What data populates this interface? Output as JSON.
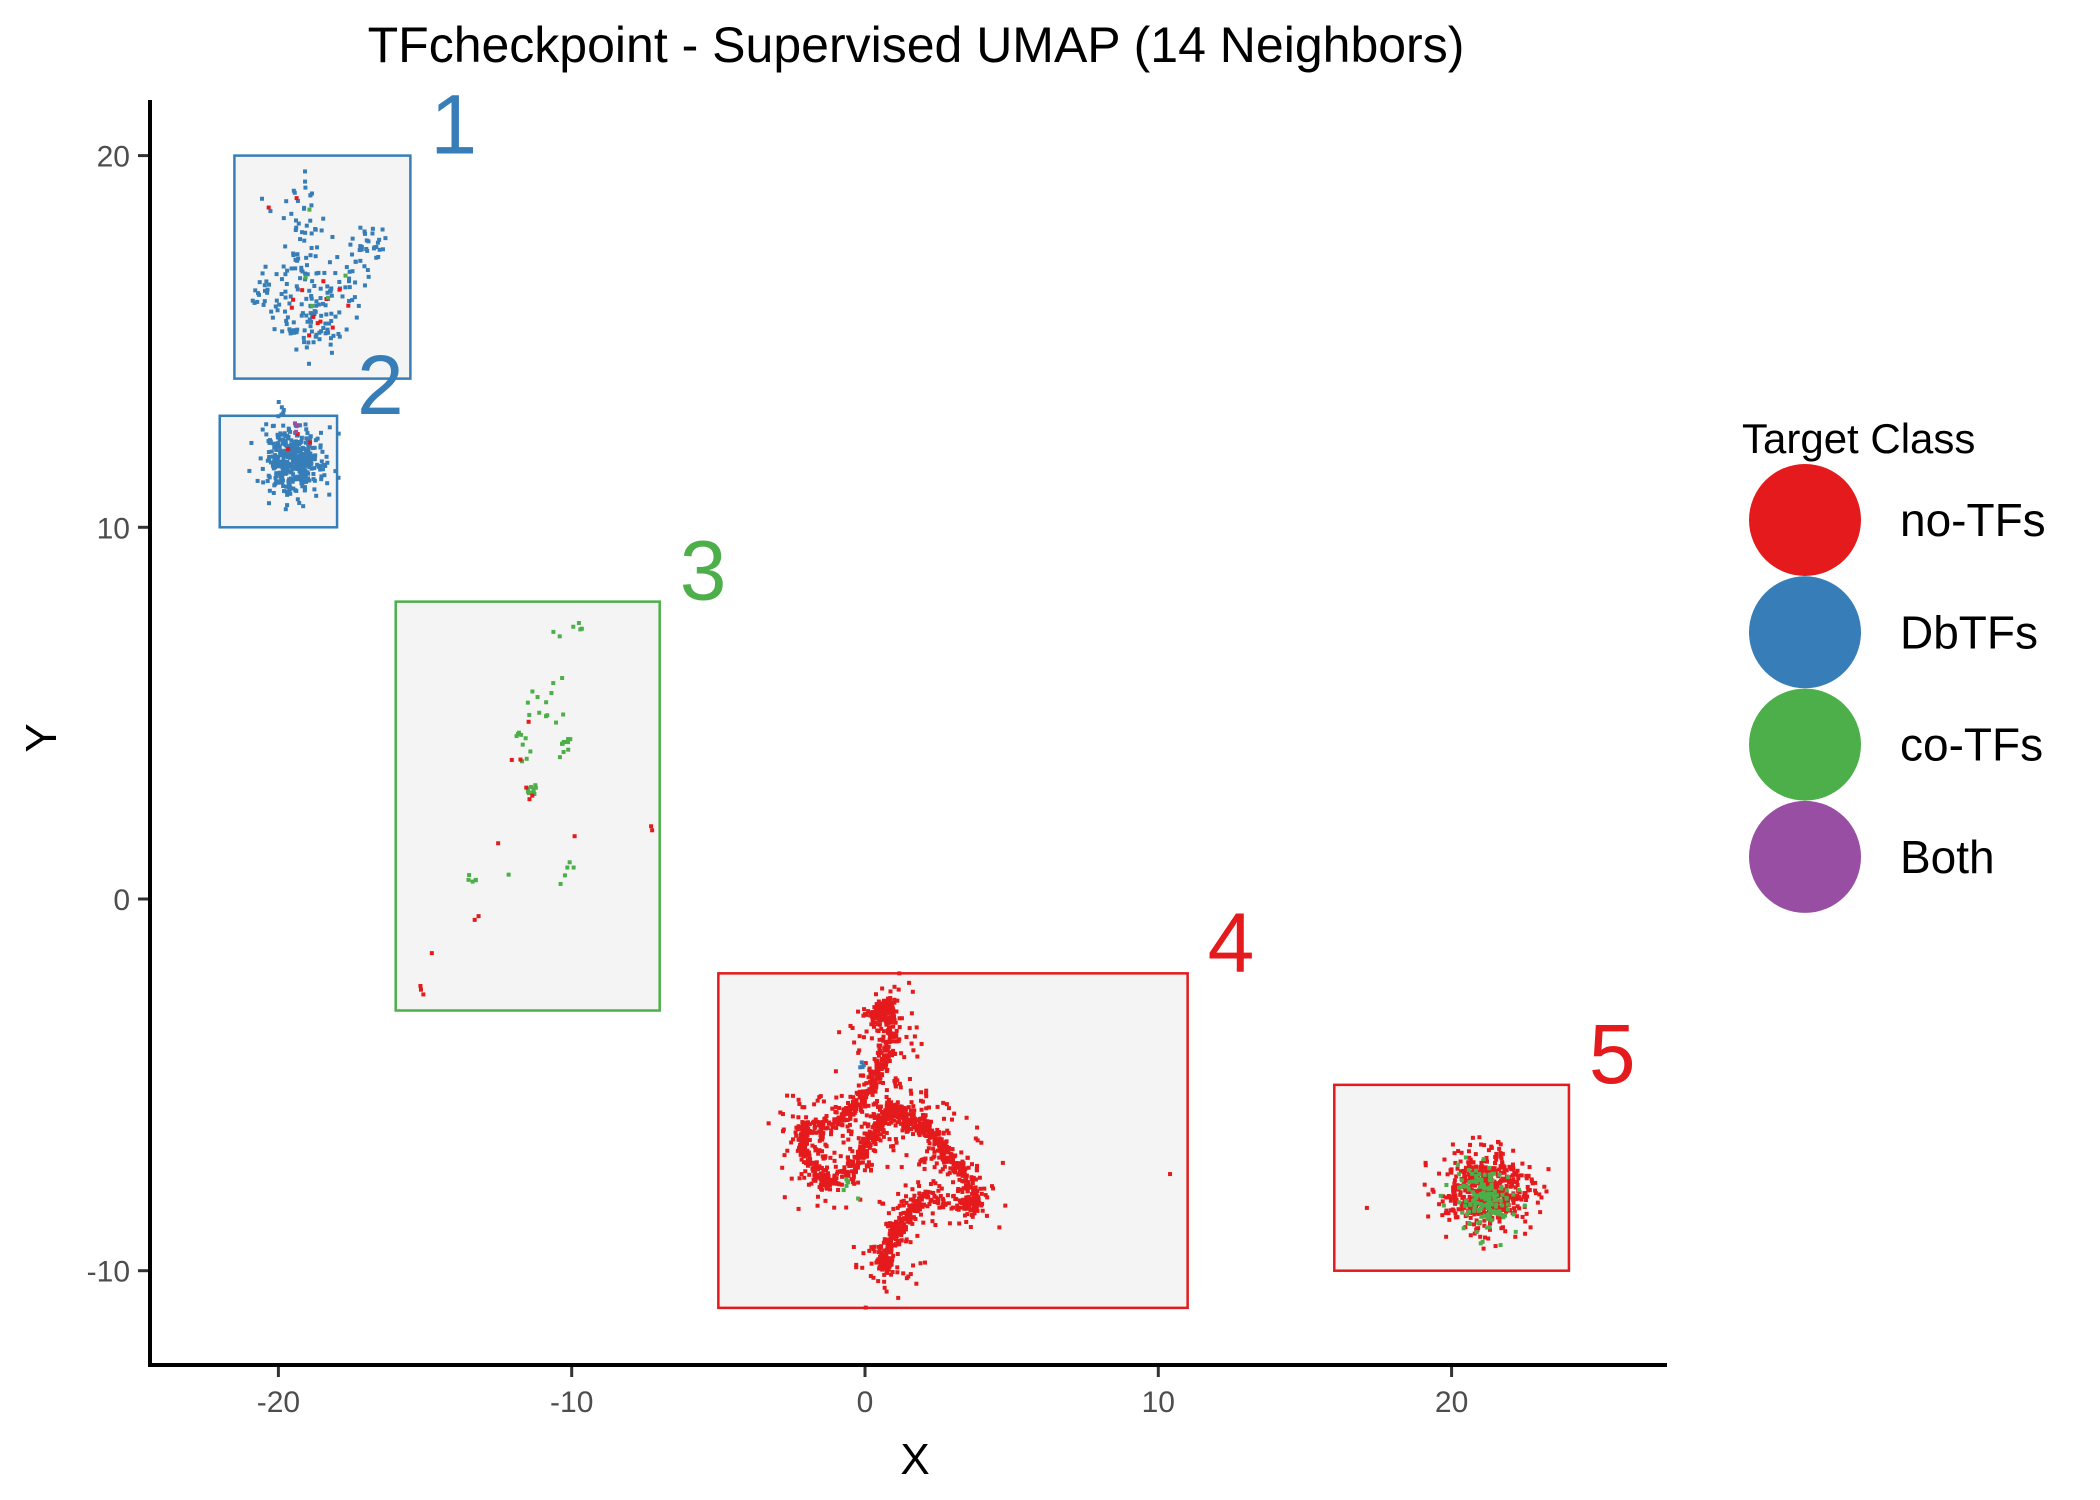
{
  "chart_data": {
    "type": "scatter",
    "title": "TFcheckpoint - Supervised UMAP (14 Neighbors)",
    "xlabel": "X",
    "ylabel": "Y",
    "xlim": [
      -24.3,
      27.2
    ],
    "ylim": [
      -12.5,
      21.6
    ],
    "xticks": [
      -20,
      -10,
      0,
      10,
      20
    ],
    "yticks": [
      -10,
      0,
      10,
      20
    ],
    "grid": false,
    "legend": {
      "title": "Target Class",
      "position": "right",
      "entries": [
        {
          "label": "no-TFs",
          "color": "#E41A1C"
        },
        {
          "label": "DbTFs",
          "color": "#377EB8"
        },
        {
          "label": "co-TFs",
          "color": "#4DAF4A"
        },
        {
          "label": "Both",
          "color": "#984EA3"
        }
      ]
    },
    "regions": [
      {
        "label": "1",
        "color": "#377EB8",
        "xmin": -21.5,
        "xmax": -15.5,
        "ymin": 14,
        "ymax": 20
      },
      {
        "label": "2",
        "color": "#377EB8",
        "xmin": -22,
        "xmax": -18,
        "ymin": 10,
        "ymax": 13
      },
      {
        "label": "3",
        "color": "#4DAF4A",
        "xmin": -16,
        "xmax": -7,
        "ymin": -3,
        "ymax": 8
      },
      {
        "label": "4",
        "color": "#E41A1C",
        "xmin": -5,
        "xmax": 11,
        "ymin": -11,
        "ymax": -2
      },
      {
        "label": "5",
        "color": "#E41A1C",
        "xmin": 16,
        "xmax": 24,
        "ymin": -10,
        "ymax": -5
      }
    ],
    "clusters": [
      {
        "region": "1",
        "class": "DbTFs",
        "count": 230,
        "shape": "branches",
        "anchors": [
          [
            -19.2,
            19.0
          ],
          [
            -19.0,
            17.8
          ],
          [
            -19.6,
            16.6
          ],
          [
            -18.6,
            16.0
          ],
          [
            -17.0,
            17.5
          ],
          [
            -20.3,
            16.2
          ],
          [
            -19.4,
            15.2
          ],
          [
            -18.4,
            15.3
          ],
          [
            -16.4,
            17.6
          ]
        ],
        "spread": 0.35
      },
      {
        "region": "1",
        "class": "no-TFs",
        "count": 14,
        "shape": "branches",
        "anchors": [
          [
            -19.2,
            18.8
          ],
          [
            -19.0,
            16.0
          ],
          [
            -18.5,
            15.5
          ],
          [
            -19.6,
            15.8
          ]
        ],
        "spread": 0.5
      },
      {
        "region": "1",
        "class": "co-TFs",
        "count": 5,
        "shape": "branches",
        "anchors": [
          [
            -19.1,
            18.6
          ],
          [
            -19.3,
            17.0
          ],
          [
            -18.8,
            15.8
          ],
          [
            -16.6,
            17.6
          ]
        ],
        "spread": 0.2
      },
      {
        "region": "2",
        "class": "DbTFs",
        "count": 420,
        "shape": "blob",
        "center": [
          -19.5,
          11.8
        ],
        "sx": 0.5,
        "sy": 0.45
      },
      {
        "region": "2",
        "class": "no-TFs",
        "count": 3,
        "shape": "blob",
        "center": [
          -19.2,
          12.4
        ],
        "sx": 0.3,
        "sy": 0.2
      },
      {
        "region": "2",
        "class": "Both",
        "count": 3,
        "shape": "blob",
        "center": [
          -19.4,
          12.7
        ],
        "sx": 0.05,
        "sy": 0.15
      },
      {
        "region": "3",
        "class": "co-TFs",
        "count": 60,
        "shape": "branches",
        "anchors": [
          [
            -11.2,
            5.4
          ],
          [
            -10.9,
            4.9
          ],
          [
            -11.8,
            4.4
          ],
          [
            -11.4,
            2.9
          ],
          [
            -10.2,
            4.2
          ],
          [
            -11.0,
            7.0
          ],
          [
            -9.7,
            7.3
          ],
          [
            -13.4,
            0.6
          ],
          [
            -10.1,
            0.8
          ],
          [
            -11.9,
            -0.3
          ]
        ],
        "spread": 0.12
      },
      {
        "region": "3",
        "class": "no-TFs",
        "count": 16,
        "shape": "branches",
        "anchors": [
          [
            -11.3,
            5.6
          ],
          [
            -12.0,
            4.0
          ],
          [
            -11.4,
            2.8
          ],
          [
            -12.6,
            1.5
          ],
          [
            -7.3,
            1.9
          ],
          [
            -13.1,
            -0.5
          ],
          [
            -15.2,
            -2.4
          ],
          [
            -11.1,
            4.8
          ]
        ],
        "spread": 0.1
      },
      {
        "region": "4",
        "class": "no-TFs",
        "count": 1900,
        "shape": "loops",
        "anchors": [
          [
            0.2,
            -3.3
          ],
          [
            0.8,
            -2.8
          ],
          [
            0.9,
            -3.8
          ],
          [
            0.4,
            -4.8
          ],
          [
            -0.2,
            -5.5
          ],
          [
            -1.0,
            -6.0
          ],
          [
            -2.2,
            -6.2
          ],
          [
            -2.0,
            -7.0
          ],
          [
            -1.3,
            -7.7
          ],
          [
            -0.4,
            -7.2
          ],
          [
            0.3,
            -6.3
          ],
          [
            0.9,
            -5.6
          ],
          [
            1.5,
            -5.9
          ],
          [
            2.2,
            -6.3
          ],
          [
            2.8,
            -6.8
          ],
          [
            3.4,
            -7.5
          ],
          [
            3.9,
            -8.3
          ],
          [
            2.0,
            -8.0
          ],
          [
            1.2,
            -8.8
          ],
          [
            0.6,
            -9.6
          ],
          [
            0.8,
            -10.0
          ]
        ],
        "spread": 0.35
      },
      {
        "region": "4",
        "class": "co-TFs",
        "count": 6,
        "shape": "blob",
        "center": [
          -0.7,
          -7.7
        ],
        "sx": 0.25,
        "sy": 0.2
      },
      {
        "region": "4",
        "class": "DbTFs",
        "count": 4,
        "shape": "blob",
        "center": [
          -0.1,
          -4.5
        ],
        "sx": 0.05,
        "sy": 0.08
      },
      {
        "region": "5",
        "class": "no-TFs",
        "count": 560,
        "shape": "blob",
        "center": [
          21.2,
          -7.8
        ],
        "sx": 0.75,
        "sy": 0.5
      },
      {
        "region": "5",
        "class": "co-TFs",
        "count": 150,
        "shape": "blob",
        "center": [
          21.1,
          -8.0
        ],
        "sx": 0.55,
        "sy": 0.45
      },
      {
        "region": "5",
        "class": "no-TFs",
        "count": 1,
        "shape": "blob",
        "center": [
          17.1,
          -8.3
        ],
        "sx": 0.02,
        "sy": 0.02
      }
    ],
    "outliers": [
      {
        "class": "no-TFs",
        "x": 10.4,
        "y": -7.4
      },
      {
        "class": "no-TFs",
        "x": 4.7,
        "y": -7.1
      }
    ]
  }
}
